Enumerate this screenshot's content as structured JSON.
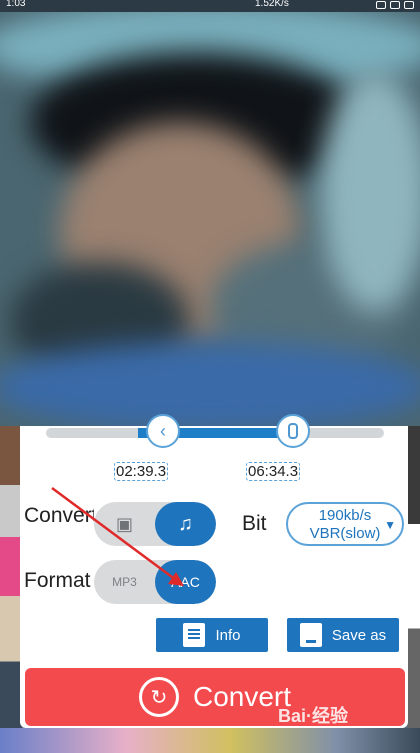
{
  "status_bar": {
    "time": "1:03",
    "speed": "1.52K/s"
  },
  "trim": {
    "start_time": "02:39.3",
    "end_time": "06:34.3"
  },
  "convert_row": {
    "label": "Convert",
    "video_icon": "video-camera-icon",
    "audio_icon": "music-note-icon",
    "selected": "audio"
  },
  "bit_row": {
    "label": "Bit",
    "value_line1": "190kb/s",
    "value_line2": "VBR(slow)"
  },
  "format_row": {
    "label": "Format",
    "option_left": "MP3",
    "option_right": "AAC",
    "selected": "AAC"
  },
  "actions": {
    "info_label": "Info",
    "save_label": "Save as"
  },
  "convert_button": {
    "label": "Convert"
  },
  "colors": {
    "accent": "#1e74bd",
    "convert": "#f24a4d"
  },
  "watermark": "Bai·经验"
}
